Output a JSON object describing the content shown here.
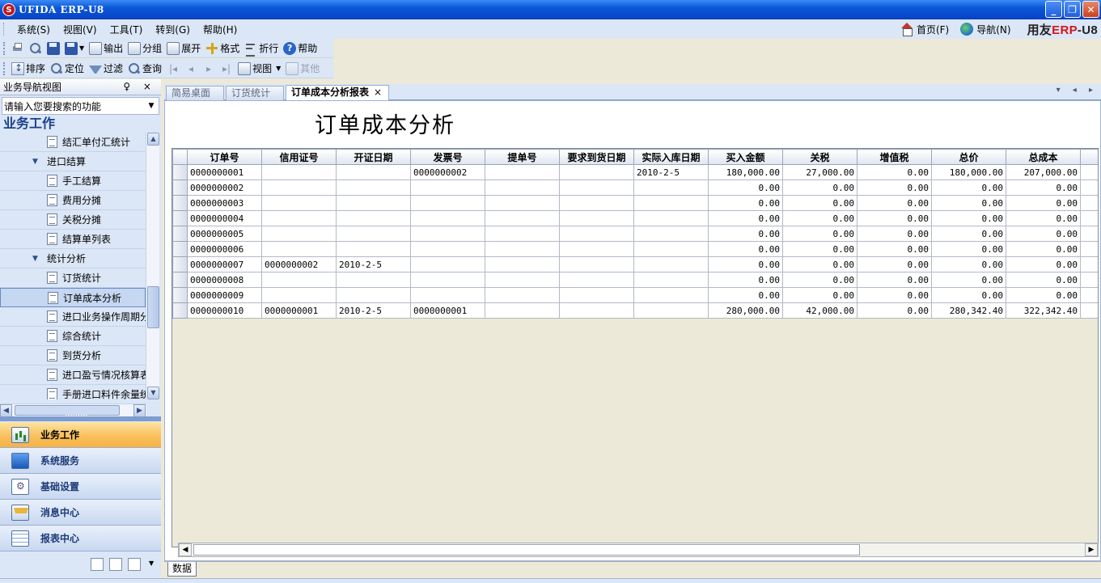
{
  "window": {
    "title": "UFIDA ERP-U8",
    "app_icon": "ufida-logo-icon",
    "minimize": "_",
    "restore": "❐",
    "close": "✕"
  },
  "menubar": {
    "items": [
      "系统(S)",
      "视图(V)",
      "工具(T)",
      "转到(G)",
      "帮助(H)"
    ],
    "home": "首页(F)",
    "navigate": "导航(N)",
    "brand_prefix": "用友",
    "brand_erp": "ERP",
    "brand_suffix": "-U8"
  },
  "toolbar1": {
    "output": "输出",
    "group": "分组",
    "expand": "展开",
    "format": "格式",
    "fold": "折行",
    "help": "帮助"
  },
  "toolbar2": {
    "sort": "排序",
    "locate": "定位",
    "filter": "过滤",
    "query": "查询",
    "view": "视图",
    "other": "其他"
  },
  "leftpanel": {
    "header": "业务导航视图",
    "header_pins": "♀ ×",
    "search_placeholder": "请输入您要搜索的功能",
    "section": "业务工作",
    "tree": [
      {
        "type": "leaf",
        "label": "结汇单付汇统计"
      },
      {
        "type": "folder",
        "label": "进口结算"
      },
      {
        "type": "leaf",
        "label": "手工结算"
      },
      {
        "type": "leaf",
        "label": "费用分摊"
      },
      {
        "type": "leaf",
        "label": "关税分摊"
      },
      {
        "type": "leaf",
        "label": "结算单列表"
      },
      {
        "type": "folder",
        "label": "统计分析"
      },
      {
        "type": "leaf",
        "label": "订货统计"
      },
      {
        "type": "leaf",
        "label": "订单成本分析",
        "selected": true
      },
      {
        "type": "leaf",
        "label": "进口业务操作周期分"
      },
      {
        "type": "leaf",
        "label": "综合统计"
      },
      {
        "type": "leaf",
        "label": "到货分析"
      },
      {
        "type": "leaf",
        "label": "进口盈亏情况核算表"
      },
      {
        "type": "leaf",
        "label": "手册进口料件余量统"
      }
    ],
    "navbars": [
      {
        "label": "业务工作",
        "icon": "chart-icon",
        "active": true
      },
      {
        "label": "系统服务",
        "icon": "monitor-icon"
      },
      {
        "label": "基础设置",
        "icon": "gear-icon"
      },
      {
        "label": "消息中心",
        "icon": "mail-icon"
      },
      {
        "label": "报表中心",
        "icon": "report-icon"
      }
    ]
  },
  "tabs": [
    {
      "label": "简易桌面"
    },
    {
      "label": "订货统计"
    },
    {
      "label": "订单成本分析报表",
      "active": true,
      "close": "×"
    }
  ],
  "tab_controls": "▾ ◂ ▸",
  "report": {
    "title": "订单成本分析",
    "columns": [
      "订单号",
      "信用证号",
      "开证日期",
      "发票号",
      "提单号",
      "要求到货日期",
      "实际入库日期",
      "买入金额",
      "关税",
      "增值税",
      "总价",
      "总成本"
    ],
    "rows": [
      [
        "0000000001",
        "",
        "",
        "0000000002",
        "",
        "",
        "2010-2-5",
        "180,000.00",
        "27,000.00",
        "0.00",
        "180,000.00",
        "207,000.00"
      ],
      [
        "0000000002",
        "",
        "",
        "",
        "",
        "",
        "",
        "0.00",
        "0.00",
        "0.00",
        "0.00",
        "0.00"
      ],
      [
        "0000000003",
        "",
        "",
        "",
        "",
        "",
        "",
        "0.00",
        "0.00",
        "0.00",
        "0.00",
        "0.00"
      ],
      [
        "0000000004",
        "",
        "",
        "",
        "",
        "",
        "",
        "0.00",
        "0.00",
        "0.00",
        "0.00",
        "0.00"
      ],
      [
        "0000000005",
        "",
        "",
        "",
        "",
        "",
        "",
        "0.00",
        "0.00",
        "0.00",
        "0.00",
        "0.00"
      ],
      [
        "0000000006",
        "",
        "",
        "",
        "",
        "",
        "",
        "0.00",
        "0.00",
        "0.00",
        "0.00",
        "0.00"
      ],
      [
        "0000000007",
        "0000000002",
        "2010-2-5",
        "",
        "",
        "",
        "",
        "0.00",
        "0.00",
        "0.00",
        "0.00",
        "0.00"
      ],
      [
        "0000000008",
        "",
        "",
        "",
        "",
        "",
        "",
        "0.00",
        "0.00",
        "0.00",
        "0.00",
        "0.00"
      ],
      [
        "0000000009",
        "",
        "",
        "",
        "",
        "",
        "",
        "0.00",
        "0.00",
        "0.00",
        "0.00",
        "0.00"
      ],
      [
        "0000000010",
        "0000000001",
        "2010-2-5",
        "0000000001",
        "",
        "",
        "",
        "280,000.00",
        "42,000.00",
        "0.00",
        "280,342.40",
        "322,342.40"
      ]
    ]
  },
  "bottom_tab": "数据"
}
